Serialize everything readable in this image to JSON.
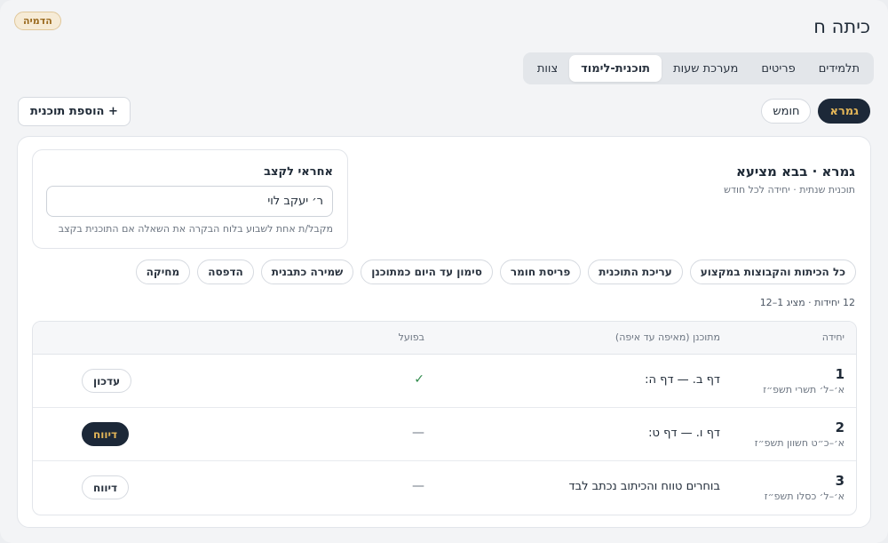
{
  "header": {
    "title": "כיתה ח",
    "demo_badge": "הדמיה"
  },
  "tabs": [
    {
      "label": "תלמידים",
      "active": false
    },
    {
      "label": "פריטים",
      "active": false
    },
    {
      "label": "מערכת שעות",
      "active": false
    },
    {
      "label": "תוכנית-לימוד",
      "active": true
    },
    {
      "label": "צוות",
      "active": false
    }
  ],
  "subjects": [
    {
      "label": "גמרא",
      "active": true
    },
    {
      "label": "חומש",
      "active": false
    }
  ],
  "add_plan_label": "+ הוספת תוכנית",
  "plan": {
    "title": "גמרא · בבא מציעא",
    "subtitle": "תוכנית שנתית · יחידה לכל חודש",
    "assignee": {
      "label": "אחראי לקצב",
      "value": "ר׳ יעקב לוי",
      "hint": "מקבל/ת אחת לשבוע בלוח הבקרה את השאלה אם התוכנית בקצב"
    },
    "actions": [
      "כל הכיתות והקבוצות במקצוע",
      "עריכת התוכנית",
      "פריסת חומר",
      "סימון עד היום כמתוכנן",
      "שמירה כתבנית",
      "הדפסה",
      "מחיקה"
    ],
    "summary": "12 יחידות · מציג 1–12"
  },
  "table": {
    "columns": {
      "unit": "יחידה",
      "planned": "מתוכנן (מאיפה עד איפה)",
      "actual": "בפועל"
    },
    "rows": [
      {
        "num": "1",
        "range": "א׳–ל׳ תשרי תשפ״ז",
        "planned": "דף ב. — דף ה:",
        "actual": "✓",
        "actual_kind": "check",
        "button": "עדכון",
        "button_dark": false
      },
      {
        "num": "2",
        "range": "א׳–כ״ט חשוון תשפ״ז",
        "planned": "דף ו. — דף ט:",
        "actual": "—",
        "actual_kind": "dash",
        "button": "דיווח",
        "button_dark": true
      },
      {
        "num": "3",
        "range": "א׳–ל׳ כסלו תשפ״ז",
        "planned": "בוחרים טווח והכיתוב נכתב לבד",
        "actual": "—",
        "actual_kind": "dash",
        "button": "דיווח",
        "button_dark": false
      }
    ]
  },
  "colors": {
    "dark_pill": "#1c2838",
    "gold_text": "#e2b558",
    "check_green": "#2e8a4a",
    "badge_bg": "#f6ebd6"
  }
}
